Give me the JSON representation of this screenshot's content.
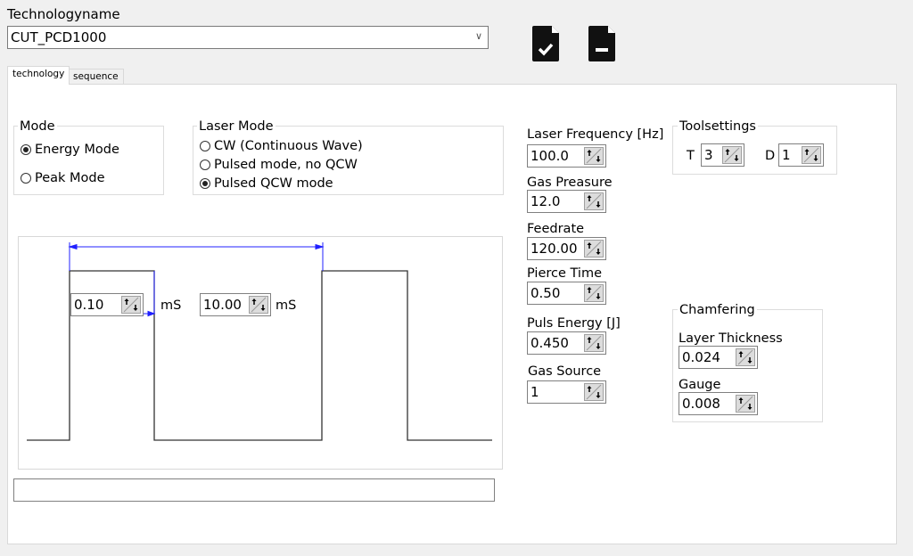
{
  "header": {
    "label": "Technologyname",
    "combo_value": "CUT_PCD1000",
    "icons": [
      "file-check-icon",
      "file-minus-icon"
    ]
  },
  "tabs": [
    {
      "label": "technology",
      "active": true
    },
    {
      "label": "sequence",
      "active": false
    }
  ],
  "mode": {
    "title": "Mode",
    "options": [
      {
        "label": "Energy Mode",
        "selected": true
      },
      {
        "label": "Peak Mode",
        "selected": false
      }
    ]
  },
  "laser_mode": {
    "title": "Laser Mode",
    "options": [
      {
        "label": "CW (Continuous Wave)",
        "selected": false
      },
      {
        "label": "Pulsed mode, no QCW",
        "selected": false
      },
      {
        "label": "Pulsed QCW mode",
        "selected": true
      }
    ]
  },
  "pulse": {
    "width_value": "0.10",
    "width_unit": "mS",
    "period_value": "10.00",
    "period_unit": "mS"
  },
  "params": [
    {
      "label": "Laser Frequency [Hz]",
      "value": "100.0"
    },
    {
      "label": "Gas Preasure",
      "value": "12.0"
    },
    {
      "label": "Feedrate",
      "value": "120.00"
    },
    {
      "label": "Pierce Time",
      "value": "0.50"
    },
    {
      "label": "Puls Energy [J]",
      "value": "0.450"
    },
    {
      "label": "Gas Source",
      "value": "1"
    }
  ],
  "toolsettings": {
    "title": "Toolsettings",
    "t_label": "T",
    "t_value": "3",
    "d_label": "D",
    "d_value": "1"
  },
  "chamfering": {
    "title": "Chamfering",
    "layer_label": "Layer Thickness",
    "layer_value": "0.024",
    "gauge_label": "Gauge",
    "gauge_value": "0.008"
  },
  "status_text": ""
}
